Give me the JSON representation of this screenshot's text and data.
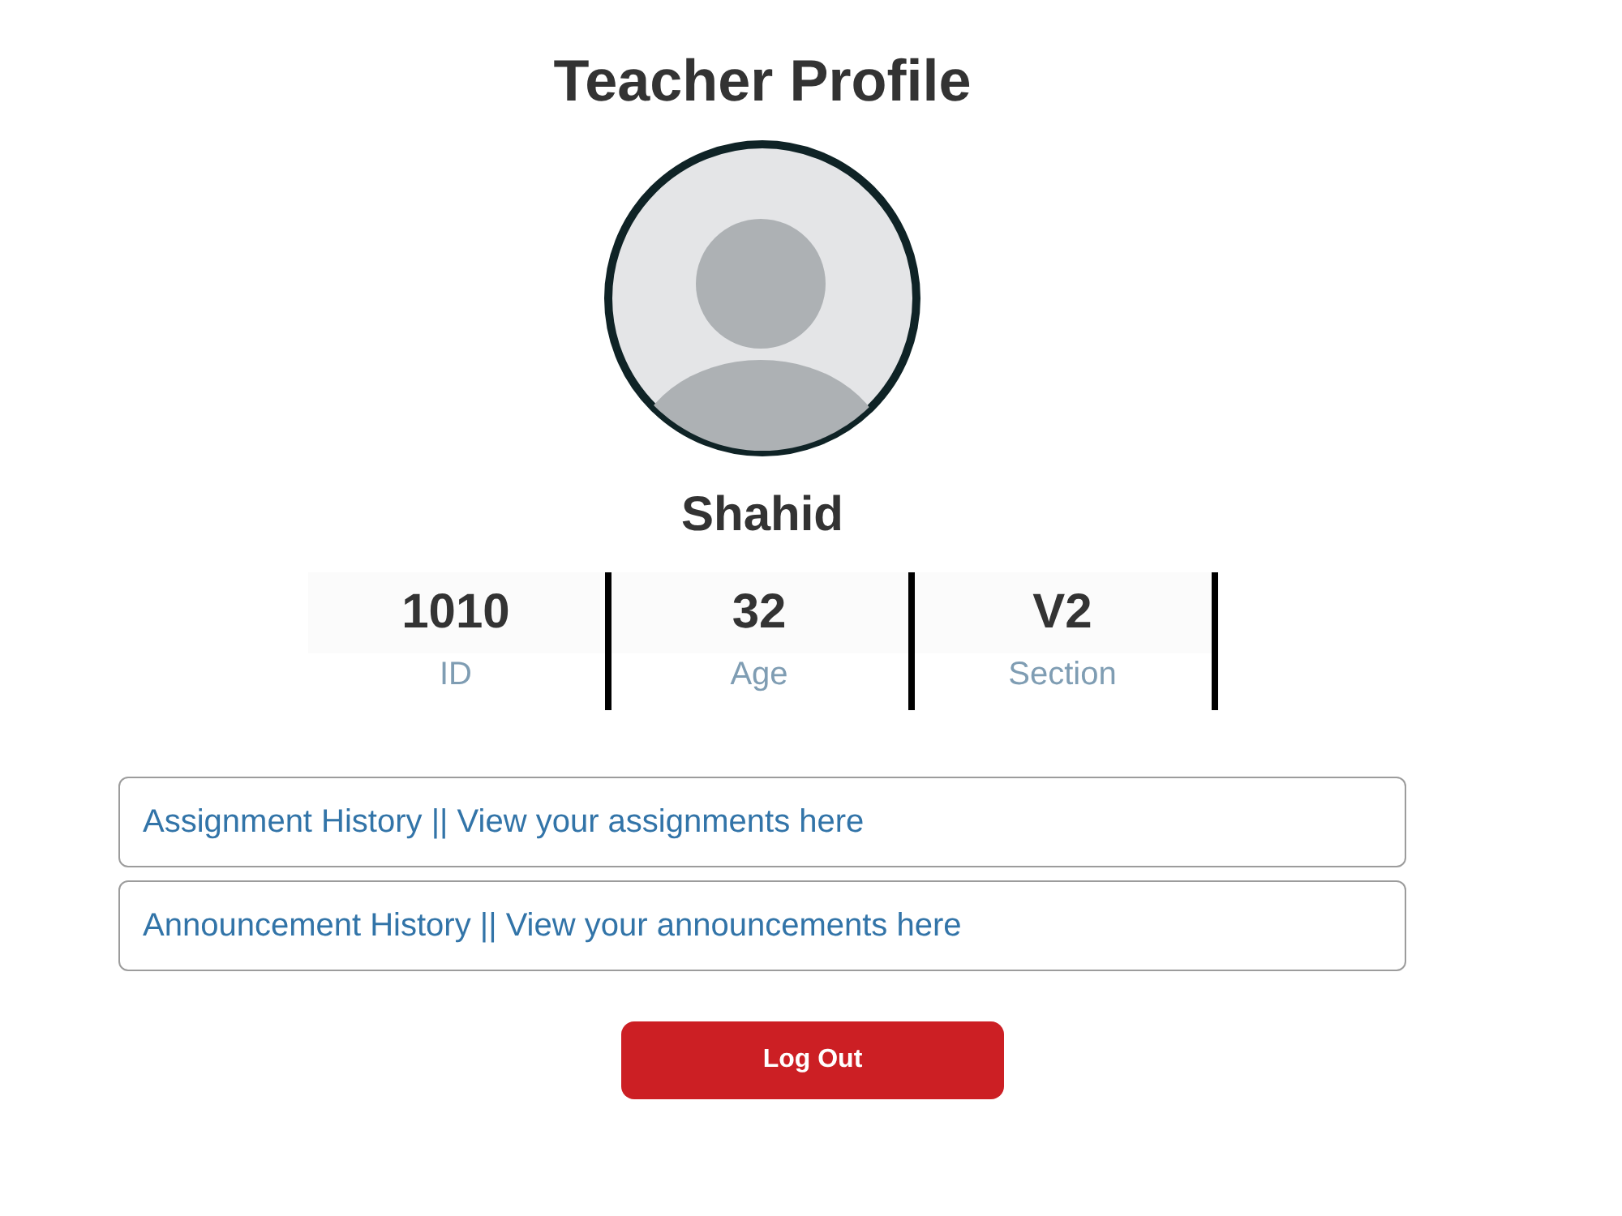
{
  "title": "Teacher Profile",
  "profile": {
    "name": "Shahid"
  },
  "stats": [
    {
      "value": "1010",
      "label": "ID"
    },
    {
      "value": "32",
      "label": "Age"
    },
    {
      "value": "V2",
      "label": "Section"
    }
  ],
  "links": [
    {
      "text": "Assignment History || View your assignments here"
    },
    {
      "text": "Announcement History || View your announcements here"
    }
  ],
  "logout_button": {
    "label": "Log Out"
  }
}
